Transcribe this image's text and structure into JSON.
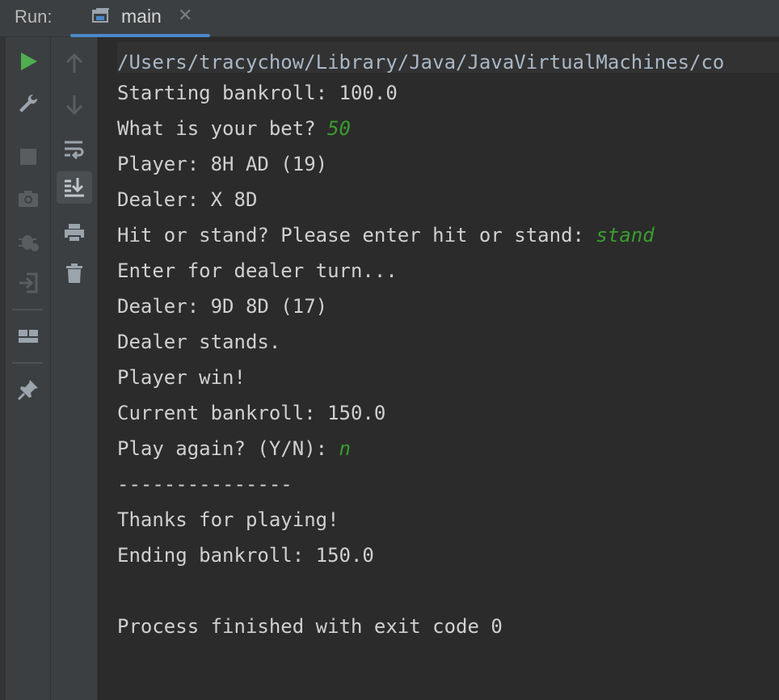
{
  "header": {
    "run_label": "Run:",
    "tab": {
      "title": "main",
      "close": "✕"
    }
  },
  "sidebar": {
    "primary_icons": [
      "run-icon",
      "wrench-icon",
      "stop-icon",
      "camera-icon",
      "debug-icon",
      "login-icon",
      "layout-icon",
      "pin-icon"
    ],
    "secondary_icons": [
      "arrow-up-icon",
      "arrow-down-icon",
      "soft-wrap-icon",
      "scroll-to-end-icon",
      "print-icon",
      "trash-icon"
    ]
  },
  "console": {
    "path": "/Users/tracychow/Library/Java/JavaVirtualMachines/co",
    "lines": [
      {
        "text": "Starting bankroll: 100.0",
        "input": ""
      },
      {
        "text": "What is your bet? ",
        "input": "50"
      },
      {
        "text": "Player: 8H AD (19)",
        "input": ""
      },
      {
        "text": "Dealer: X 8D",
        "input": ""
      },
      {
        "text": "Hit or stand? Please enter hit or stand: ",
        "input": "stand"
      },
      {
        "text": "Enter for dealer turn...",
        "input": ""
      },
      {
        "text": "Dealer: 9D 8D (17)",
        "input": ""
      },
      {
        "text": "Dealer stands.",
        "input": ""
      },
      {
        "text": "Player win!",
        "input": ""
      },
      {
        "text": "Current bankroll: 150.0",
        "input": ""
      },
      {
        "text": "Play again? (Y/N): ",
        "input": "n"
      },
      {
        "text": "---------------",
        "input": ""
      },
      {
        "text": "Thanks for playing!",
        "input": ""
      },
      {
        "text": "Ending bankroll: 150.0",
        "input": ""
      },
      {
        "text": "",
        "input": ""
      },
      {
        "text": "Process finished with exit code 0",
        "input": ""
      }
    ]
  },
  "colors": {
    "background": "#2b2b2b",
    "panel": "#3c3f41",
    "text": "#d0d0d0",
    "user_input": "#3a9d2f",
    "run_green": "#4fae4f",
    "accent_blue": "#4a88c7"
  }
}
